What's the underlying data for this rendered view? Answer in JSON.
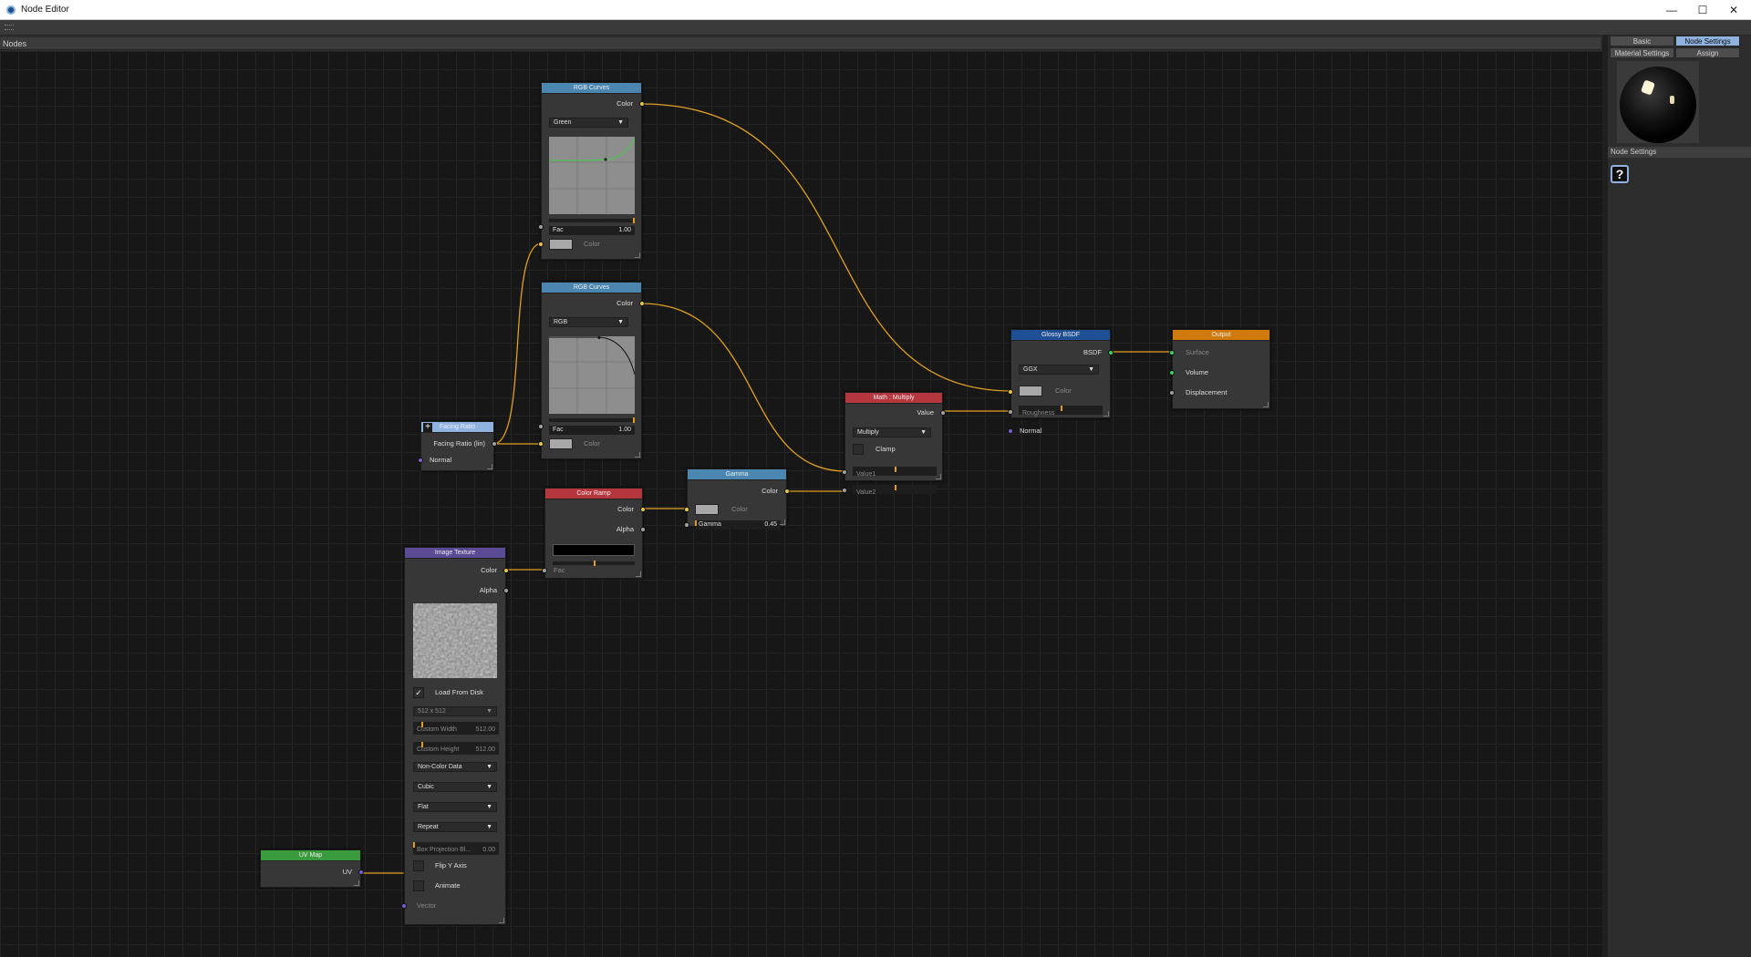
{
  "window": {
    "title": "Node Editor",
    "minimize": "—",
    "maximize": "☐",
    "close": "✕"
  },
  "left_panel": {
    "header": "Nodes"
  },
  "right_panel": {
    "tabs": [
      {
        "label": "Basic",
        "active": false
      },
      {
        "label": "Node Settings",
        "active": true
      },
      {
        "label": "Material Settings",
        "active": false
      },
      {
        "label": "Assign",
        "active": false
      }
    ],
    "section_label": "Node Settings",
    "help_icon": "?"
  },
  "nodes": {
    "rgb_curves_1": {
      "title": "RGB Curves",
      "header_color": "#4a86b0",
      "out_color": "Color",
      "channel": "Green",
      "fac_label": "Fac",
      "fac_value": "1.00",
      "in_color": "Color"
    },
    "rgb_curves_2": {
      "title": "RGB Curves",
      "header_color": "#4a86b0",
      "out_color": "Color",
      "channel": "RGB",
      "fac_label": "Fac",
      "fac_value": "1.00",
      "in_color": "Color"
    },
    "facing_ratio": {
      "title": "Facing Ratio",
      "header_color": "#8fb3de",
      "add_icon": "+",
      "out": "Facing Ratio (lin)",
      "in_normal": "Normal"
    },
    "color_ramp": {
      "title": "Color Ramp",
      "header_color": "#b5363c",
      "out_color": "Color",
      "out_alpha": "Alpha",
      "in_fac": "Fac"
    },
    "gamma": {
      "title": "Gamma",
      "header_color": "#4a86b0",
      "out_color": "Color",
      "in_color": "Color",
      "gamma_label": "Gamma",
      "gamma_value": "0.45"
    },
    "math_multiply": {
      "title": "Math : Multiply",
      "header_color": "#b5363c",
      "out_value": "Value",
      "operation": "Multiply",
      "clamp": "Clamp",
      "value1": "Value1",
      "value2": "Value2"
    },
    "glossy_bsdf": {
      "title": "Glossy BSDF",
      "header_color": "#1f4f94",
      "out_bsdf": "BSDF",
      "distribution": "GGX",
      "in_color": "Color",
      "in_roughness": "Roughness",
      "in_normal": "Normal"
    },
    "output": {
      "title": "Output",
      "header_color": "#d07a0e",
      "in_surface": "Surface",
      "in_volume": "Volume",
      "in_displacement": "Displacement"
    },
    "image_texture": {
      "title": "Image Texture",
      "header_color": "#5a4b94",
      "out_color": "Color",
      "out_alpha": "Alpha",
      "load_from_disk": "Load From Disk",
      "load_from_disk_checked": true,
      "resolution": "512 x 512",
      "custom_width_label": "Custom Width",
      "custom_width_value": "512.00",
      "custom_height_label": "Custom Height",
      "custom_height_value": "512.00",
      "colorspace": "Non-Color Data",
      "interpolation": "Cubic",
      "projection": "Flat",
      "extension": "Repeat",
      "box_blend_label": "Box Projection Bl...",
      "box_blend_value": "0.00",
      "flip_y": "Flip Y Axis",
      "animate": "Animate",
      "in_vector": "Vector"
    },
    "uv_map": {
      "title": "UV Map",
      "header_color": "#3a9a3e",
      "out_uv": "UV"
    }
  },
  "colors": {
    "link": "#e0a020",
    "socket_color": "#e8c840",
    "socket_float": "#a0a0a0",
    "socket_vector": "#7a5ad8",
    "socket_shader": "#3ad060"
  }
}
